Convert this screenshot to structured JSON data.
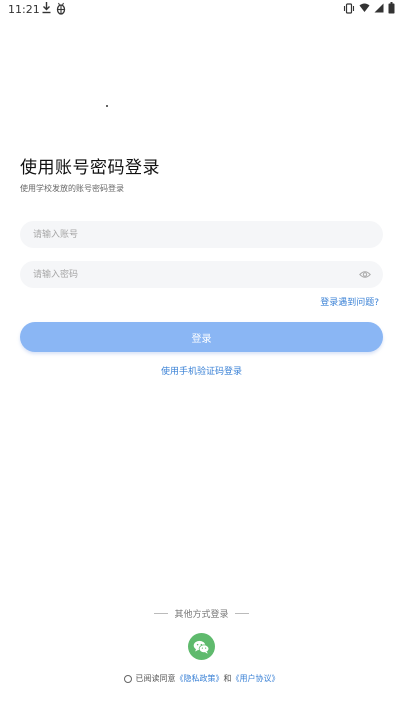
{
  "status_bar": {
    "time": "11:21",
    "icons": [
      "download-icon",
      "bug-icon",
      "vibrate-icon",
      "wifi-icon",
      "signal-icon",
      "battery-icon"
    ]
  },
  "login": {
    "title": "使用账号密码登录",
    "subtitle": "使用学校发放的账号密码登录",
    "account_placeholder": "请输入账号",
    "password_placeholder": "请输入密码",
    "problem_link": "登录遇到问题?",
    "login_button": "登录",
    "phone_login_link": "使用手机验证码登录"
  },
  "other": {
    "label": "其他方式登录"
  },
  "agreement": {
    "prefix": "已阅读同意",
    "privacy": "《隐私政策》",
    "and": "和",
    "user_agreement": "《用户协议》"
  },
  "colors": {
    "accent": "#3b82d6",
    "button": "#8ab6f4",
    "wechat": "#5fba6d"
  }
}
